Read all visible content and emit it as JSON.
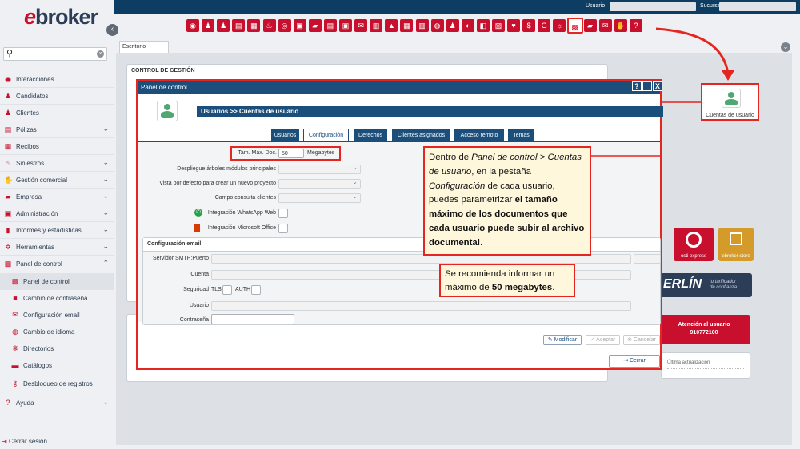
{
  "topbar": {
    "usuario_label": "Usuario",
    "sucursal_label": "Sucursal"
  },
  "brand": {
    "first": "e",
    "rest": "broker",
    "accent": "#c8102e",
    "navy": "#1b4e7a"
  },
  "search": {
    "placeholder": ""
  },
  "sidebar": {
    "items": [
      {
        "label": "Interacciones",
        "icon": "globe-icon",
        "glyph": "◉",
        "chevron": ""
      },
      {
        "label": "Candidatos",
        "icon": "user-add-icon",
        "glyph": "♟",
        "chevron": ""
      },
      {
        "label": "Clientes",
        "icon": "clients-icon",
        "glyph": "♟",
        "chevron": ""
      },
      {
        "label": "Pólizas",
        "icon": "policy-icon",
        "glyph": "▤",
        "chevron": "⌄"
      },
      {
        "label": "Recibos",
        "icon": "receipt-icon",
        "glyph": "▦",
        "chevron": ""
      },
      {
        "label": "Siniestros",
        "icon": "fire-icon",
        "glyph": "♨",
        "chevron": "⌄"
      },
      {
        "label": "Gestión comercial",
        "icon": "handshake-icon",
        "glyph": "✋",
        "chevron": "⌄"
      },
      {
        "label": "Empresa",
        "icon": "folder-icon",
        "glyph": "▰",
        "chevron": "⌄"
      },
      {
        "label": "Administración",
        "icon": "calculator-icon",
        "glyph": "▣",
        "chevron": "⌄"
      },
      {
        "label": "Informes y estadísticas",
        "icon": "bar-chart-icon",
        "glyph": "▮",
        "chevron": "⌄"
      },
      {
        "label": "Herramientas",
        "icon": "gear-icon",
        "glyph": "✲",
        "chevron": "⌄"
      },
      {
        "label": "Panel de control",
        "icon": "cubes-icon",
        "glyph": "▩",
        "chevron": "⌃"
      },
      {
        "label": "Panel de control",
        "icon": "cubes-icon",
        "glyph": "▩",
        "chevron": ""
      },
      {
        "label": "Cambio de contraseña",
        "icon": "lock-icon",
        "glyph": "■",
        "chevron": ""
      },
      {
        "label": "Configuración email",
        "icon": "envelope-icon",
        "glyph": "✉",
        "chevron": ""
      },
      {
        "label": "Cambio de idioma",
        "icon": "language-icon",
        "glyph": "◍",
        "chevron": ""
      },
      {
        "label": "Directorios",
        "icon": "sitemap-icon",
        "glyph": "❋",
        "chevron": ""
      },
      {
        "label": "Catálogos",
        "icon": "book-icon",
        "glyph": "▬",
        "chevron": ""
      },
      {
        "label": "Desbloqueo de registros",
        "icon": "key-icon",
        "glyph": "⚷",
        "chevron": ""
      },
      {
        "label": "Ayuda",
        "icon": "help-icon",
        "glyph": "?",
        "chevron": "⌄"
      }
    ],
    "logout": "Cerrar sesión"
  },
  "toolbar": {
    "icons": [
      "◉",
      "♟",
      "♟",
      "▤",
      "▦",
      "♨",
      "◎",
      "▣",
      "▰",
      "▤",
      "▣",
      "✉",
      "▥",
      "▲",
      "▦",
      "▥",
      "◍",
      "♟",
      "◐",
      "◧",
      "▨",
      "♥",
      "$",
      "G",
      "☼",
      "▩",
      "▰",
      "✉",
      "✋",
      "?"
    ]
  },
  "tabs": {
    "escritorio": "Escritorio"
  },
  "desk": {
    "control_gestion": "CONTROL DE GESTIÓN"
  },
  "dialog": {
    "title": "Panel de control",
    "window_buttons": [
      "?",
      "_",
      "X"
    ],
    "subtitle": "Usuarios >> Cuentas de usuario",
    "tabs": [
      "Usuarios",
      "Configuración",
      "Derechos",
      "Clientes asignados",
      "Acceso remoto",
      "Temas"
    ],
    "active_tab": "Configuración",
    "fields": {
      "tam_label": "Tam. Máx. Doc.",
      "tam_value": "50",
      "tam_unit": "Megabytes",
      "despliegue": "Despliegue árboles módulos principales",
      "vista": "Vista por defecto para crear un nuevo proyecto",
      "campo": "Campo consulta clientes",
      "whatsapp": "Integración WhatsApp Web",
      "office": "Integración Microsoft Office"
    },
    "email": {
      "header": "Configuración email",
      "smtp": "Servidor SMTP:Puerto",
      "cuenta": "Cuenta",
      "seguridad": "Seguridad",
      "tls": "TLS",
      "auth": "AUTH",
      "usuario": "Usuario",
      "contrasena": "Contraseña"
    },
    "buttons": {
      "modificar": "Modificar",
      "aceptar": "Aceptar",
      "cancelar": "Cancelar",
      "cerrar": "Cerrar"
    }
  },
  "callout1": {
    "t1": "Dentro de ",
    "i1": "Panel de control > Cuentas de usuario",
    "t2": ", en la pestaña ",
    "i2": "Configuración",
    "t3": " de cada usuario, puedes parametrizar ",
    "b1": "el tamaño máximo de los documentos que cada usuario puede subir al archivo documental",
    "t4": "."
  },
  "callout2": {
    "t1": "Se recomienda informar un máximo de ",
    "b1": "50 megabytes",
    "t2": "."
  },
  "preview": {
    "label": "Cuentas de usuario"
  },
  "right_tiles": {
    "osti": "osti express",
    "store": "ebroker store",
    "merlin": "ERLÍN",
    "merlin_tag1": "tu tarificador",
    "merlin_tag2": "de confianza",
    "atencion": "Atención al usuario",
    "phone": "910772100",
    "ultima": "Última actualización"
  }
}
